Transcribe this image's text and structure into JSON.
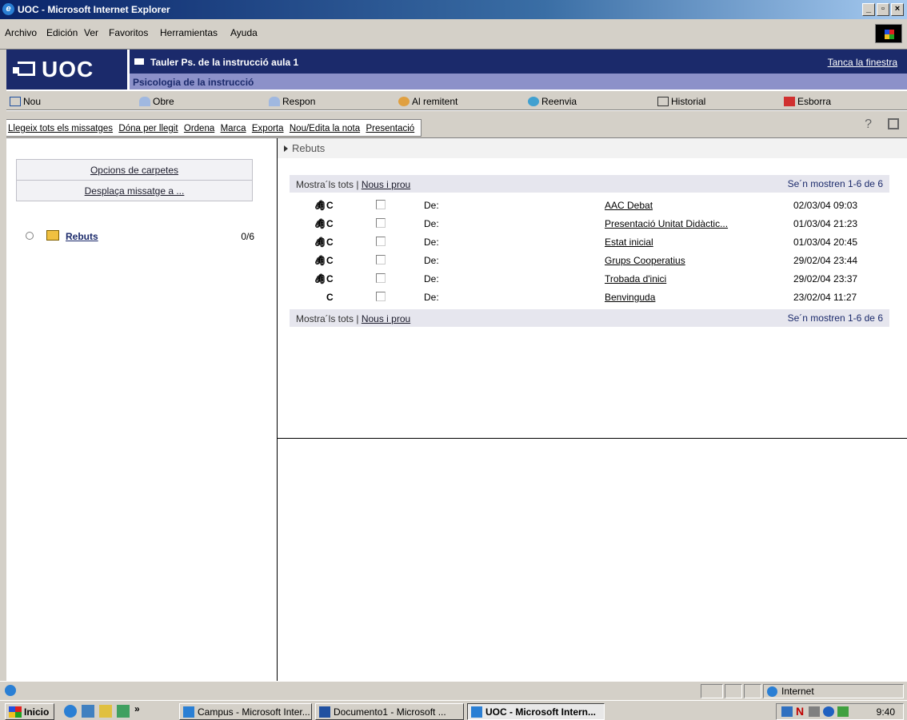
{
  "window": {
    "title": "UOC - Microsoft Internet Explorer"
  },
  "menu": [
    "Archivo",
    "Edición",
    "Ver",
    "Favoritos",
    "Herramientas",
    "Ayuda"
  ],
  "header": {
    "logo": "UOC",
    "board_title": "Tauler Ps. de la instrucció aula 1",
    "subject": "Psicologia de la instrucció",
    "close_window": "Tanca la finestra"
  },
  "toolbar": [
    "Nou",
    "Obre",
    "Respon",
    "Al remitent",
    "Reenvia",
    "Historial",
    "Esborra"
  ],
  "actions": [
    "Llegeix tots els missatges",
    "Dóna per llegit",
    "Ordena",
    "Marca",
    "Exporta",
    "Nou/Edita la nota",
    "Presentació"
  ],
  "left": {
    "folder_options": "Opcions de carpetes",
    "move_message": "Desplaça missatge a ...",
    "folder_name": "Rebuts",
    "folder_count": "0/6"
  },
  "right": {
    "folder_header": "Rebuts",
    "show_all": "Mostra´ls tots |",
    "new_more": "Nous i prou",
    "showing": "Se´n mostren 1-6 de 6"
  },
  "messages": [
    {
      "clip": "🖇",
      "flag": "C",
      "from": "De:",
      "subject": "AAC Debat",
      "date": "02/03/04 09:03"
    },
    {
      "clip": "🖇",
      "flag": "C",
      "from": "De:",
      "subject": "Presentació Unitat Didàctic...",
      "date": "01/03/04 21:23"
    },
    {
      "clip": "🖇",
      "flag": "C",
      "from": "De:",
      "subject": "Estat inicial",
      "date": "01/03/04 20:45"
    },
    {
      "clip": "🖇",
      "flag": "C",
      "from": "De:",
      "subject": "Grups Cooperatius",
      "date": "29/02/04 23:44"
    },
    {
      "clip": "🖇",
      "flag": "C",
      "from": "De:",
      "subject": "Trobada d'inici",
      "date": "29/02/04 23:37"
    },
    {
      "clip": "",
      "flag": "C",
      "from": "De:",
      "subject": "Benvinguda",
      "date": "23/02/04 11:27"
    }
  ],
  "status": {
    "zone": "Internet"
  },
  "taskbar": {
    "start": "Inicio",
    "items": [
      "Campus - Microsoft Inter...",
      "Documento1 - Microsoft ...",
      "UOC - Microsoft Intern..."
    ],
    "clock": "9:40"
  }
}
